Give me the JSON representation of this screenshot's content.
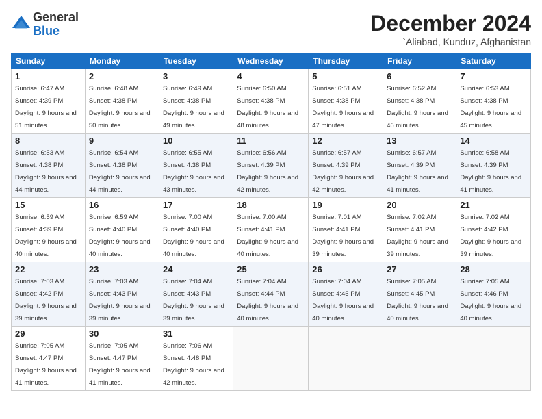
{
  "logo": {
    "general": "General",
    "blue": "Blue"
  },
  "header": {
    "month": "December 2024",
    "location": "`Aliabad, Kunduz, Afghanistan"
  },
  "weekdays": [
    "Sunday",
    "Monday",
    "Tuesday",
    "Wednesday",
    "Thursday",
    "Friday",
    "Saturday"
  ],
  "weeks": [
    [
      {
        "day": 1,
        "sunrise": "6:47 AM",
        "sunset": "4:39 PM",
        "daylight": "9 hours and 51 minutes"
      },
      {
        "day": 2,
        "sunrise": "6:48 AM",
        "sunset": "4:38 PM",
        "daylight": "9 hours and 50 minutes"
      },
      {
        "day": 3,
        "sunrise": "6:49 AM",
        "sunset": "4:38 PM",
        "daylight": "9 hours and 49 minutes"
      },
      {
        "day": 4,
        "sunrise": "6:50 AM",
        "sunset": "4:38 PM",
        "daylight": "9 hours and 48 minutes"
      },
      {
        "day": 5,
        "sunrise": "6:51 AM",
        "sunset": "4:38 PM",
        "daylight": "9 hours and 47 minutes"
      },
      {
        "day": 6,
        "sunrise": "6:52 AM",
        "sunset": "4:38 PM",
        "daylight": "9 hours and 46 minutes"
      },
      {
        "day": 7,
        "sunrise": "6:53 AM",
        "sunset": "4:38 PM",
        "daylight": "9 hours and 45 minutes"
      }
    ],
    [
      {
        "day": 8,
        "sunrise": "6:53 AM",
        "sunset": "4:38 PM",
        "daylight": "9 hours and 44 minutes"
      },
      {
        "day": 9,
        "sunrise": "6:54 AM",
        "sunset": "4:38 PM",
        "daylight": "9 hours and 44 minutes"
      },
      {
        "day": 10,
        "sunrise": "6:55 AM",
        "sunset": "4:38 PM",
        "daylight": "9 hours and 43 minutes"
      },
      {
        "day": 11,
        "sunrise": "6:56 AM",
        "sunset": "4:39 PM",
        "daylight": "9 hours and 42 minutes"
      },
      {
        "day": 12,
        "sunrise": "6:57 AM",
        "sunset": "4:39 PM",
        "daylight": "9 hours and 42 minutes"
      },
      {
        "day": 13,
        "sunrise": "6:57 AM",
        "sunset": "4:39 PM",
        "daylight": "9 hours and 41 minutes"
      },
      {
        "day": 14,
        "sunrise": "6:58 AM",
        "sunset": "4:39 PM",
        "daylight": "9 hours and 41 minutes"
      }
    ],
    [
      {
        "day": 15,
        "sunrise": "6:59 AM",
        "sunset": "4:39 PM",
        "daylight": "9 hours and 40 minutes"
      },
      {
        "day": 16,
        "sunrise": "6:59 AM",
        "sunset": "4:40 PM",
        "daylight": "9 hours and 40 minutes"
      },
      {
        "day": 17,
        "sunrise": "7:00 AM",
        "sunset": "4:40 PM",
        "daylight": "9 hours and 40 minutes"
      },
      {
        "day": 18,
        "sunrise": "7:00 AM",
        "sunset": "4:41 PM",
        "daylight": "9 hours and 40 minutes"
      },
      {
        "day": 19,
        "sunrise": "7:01 AM",
        "sunset": "4:41 PM",
        "daylight": "9 hours and 39 minutes"
      },
      {
        "day": 20,
        "sunrise": "7:02 AM",
        "sunset": "4:41 PM",
        "daylight": "9 hours and 39 minutes"
      },
      {
        "day": 21,
        "sunrise": "7:02 AM",
        "sunset": "4:42 PM",
        "daylight": "9 hours and 39 minutes"
      }
    ],
    [
      {
        "day": 22,
        "sunrise": "7:03 AM",
        "sunset": "4:42 PM",
        "daylight": "9 hours and 39 minutes"
      },
      {
        "day": 23,
        "sunrise": "7:03 AM",
        "sunset": "4:43 PM",
        "daylight": "9 hours and 39 minutes"
      },
      {
        "day": 24,
        "sunrise": "7:04 AM",
        "sunset": "4:43 PM",
        "daylight": "9 hours and 39 minutes"
      },
      {
        "day": 25,
        "sunrise": "7:04 AM",
        "sunset": "4:44 PM",
        "daylight": "9 hours and 40 minutes"
      },
      {
        "day": 26,
        "sunrise": "7:04 AM",
        "sunset": "4:45 PM",
        "daylight": "9 hours and 40 minutes"
      },
      {
        "day": 27,
        "sunrise": "7:05 AM",
        "sunset": "4:45 PM",
        "daylight": "9 hours and 40 minutes"
      },
      {
        "day": 28,
        "sunrise": "7:05 AM",
        "sunset": "4:46 PM",
        "daylight": "9 hours and 40 minutes"
      }
    ],
    [
      {
        "day": 29,
        "sunrise": "7:05 AM",
        "sunset": "4:47 PM",
        "daylight": "9 hours and 41 minutes"
      },
      {
        "day": 30,
        "sunrise": "7:05 AM",
        "sunset": "4:47 PM",
        "daylight": "9 hours and 41 minutes"
      },
      {
        "day": 31,
        "sunrise": "7:06 AM",
        "sunset": "4:48 PM",
        "daylight": "9 hours and 42 minutes"
      },
      null,
      null,
      null,
      null
    ]
  ]
}
